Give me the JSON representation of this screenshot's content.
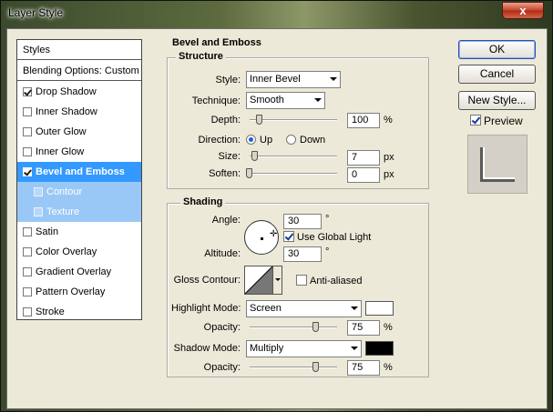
{
  "window": {
    "title": "Layer Style",
    "close_glyph": "x"
  },
  "styles_list": {
    "header": "Styles",
    "blending": "Blending Options: Custom",
    "items": [
      {
        "label": "Drop Shadow",
        "checked": true
      },
      {
        "label": "Inner Shadow",
        "checked": false
      },
      {
        "label": "Outer Glow",
        "checked": false
      },
      {
        "label": "Inner Glow",
        "checked": false
      },
      {
        "label": "Bevel and Emboss",
        "checked": true,
        "selected": true
      },
      {
        "label": "Contour",
        "checked": false,
        "sub": true
      },
      {
        "label": "Texture",
        "checked": false,
        "sub": true
      },
      {
        "label": "Satin",
        "checked": false
      },
      {
        "label": "Color Overlay",
        "checked": false
      },
      {
        "label": "Gradient Overlay",
        "checked": false
      },
      {
        "label": "Pattern Overlay",
        "checked": false
      },
      {
        "label": "Stroke",
        "checked": false
      }
    ]
  },
  "bevel": {
    "section_title": "Bevel and Emboss",
    "structure": {
      "title": "Structure",
      "style_label": "Style:",
      "style_value": "Inner Bevel",
      "technique_label": "Technique:",
      "technique_value": "Smooth",
      "depth_label": "Depth:",
      "depth_value": "100",
      "depth_unit": "%",
      "direction_label": "Direction:",
      "dir_up": "Up",
      "dir_down": "Down",
      "size_label": "Size:",
      "size_value": "7",
      "size_unit": "px",
      "soften_label": "Soften:",
      "soften_value": "0",
      "soften_unit": "px"
    },
    "shading": {
      "title": "Shading",
      "angle_label": "Angle:",
      "angle_value": "30",
      "angle_unit": "°",
      "global_light_label": "Use Global Light",
      "altitude_label": "Altitude:",
      "altitude_value": "30",
      "altitude_unit": "°",
      "gloss_label": "Gloss Contour:",
      "anti_aliased_label": "Anti-aliased",
      "highlight_mode_label": "Highlight Mode:",
      "highlight_mode_value": "Screen",
      "highlight_color": "#ffffff",
      "highlight_opacity_label": "Opacity:",
      "highlight_opacity_value": "75",
      "highlight_opacity_unit": "%",
      "shadow_mode_label": "Shadow Mode:",
      "shadow_mode_value": "Multiply",
      "shadow_color": "#000000",
      "shadow_opacity_label": "Opacity:",
      "shadow_opacity_value": "75",
      "shadow_opacity_unit": "%"
    }
  },
  "buttons": {
    "ok": "OK",
    "cancel": "Cancel",
    "new_style": "New Style...",
    "preview_label": "Preview"
  }
}
